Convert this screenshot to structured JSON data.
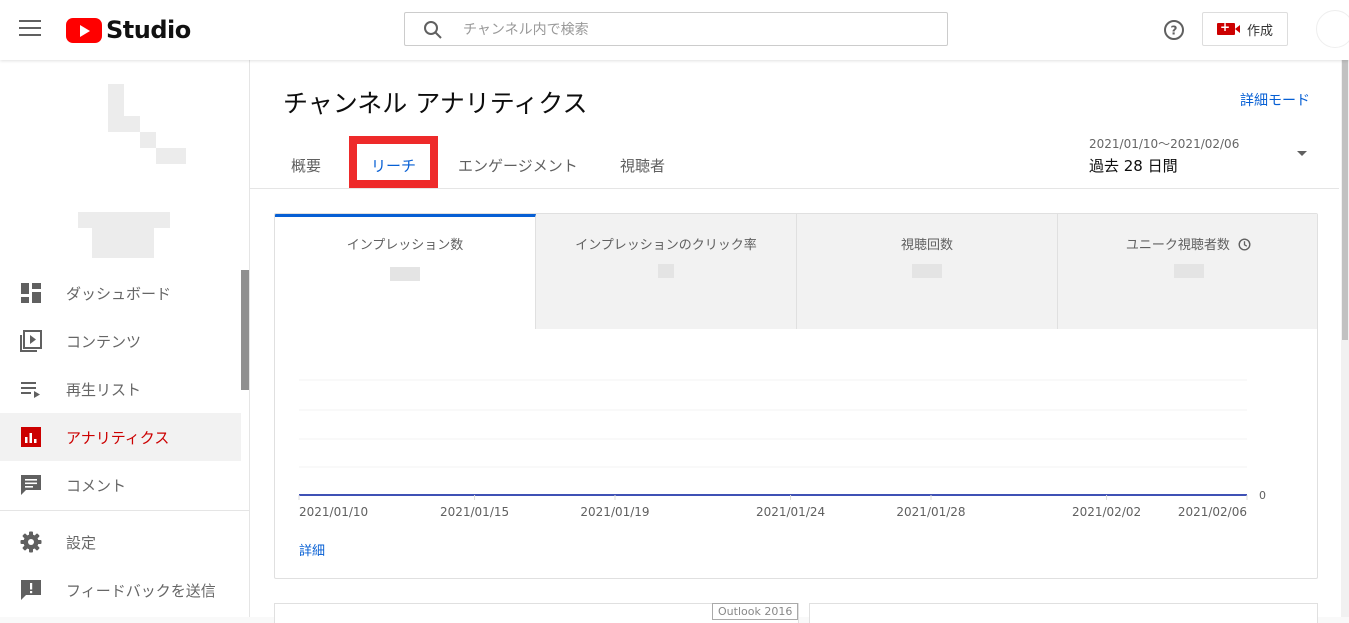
{
  "header": {
    "brand": "Studio",
    "search_placeholder": "チャンネル内で検索",
    "create_label": "作成"
  },
  "sidebar": {
    "items": [
      {
        "label": "ダッシュボード",
        "icon": "dashboard-icon",
        "active": false
      },
      {
        "label": "コンテンツ",
        "icon": "content-icon",
        "active": false
      },
      {
        "label": "再生リスト",
        "icon": "playlist-icon",
        "active": false
      },
      {
        "label": "アナリティクス",
        "icon": "analytics-icon",
        "active": true
      },
      {
        "label": "コメント",
        "icon": "comment-icon",
        "active": false
      }
    ],
    "bottom_items": [
      {
        "label": "設定",
        "icon": "gear-icon"
      },
      {
        "label": "フィードバックを送信",
        "icon": "feedback-icon"
      }
    ]
  },
  "main": {
    "title": "チャンネル アナリティクス",
    "advanced_mode": "詳細モード",
    "tabs": [
      {
        "label": "概要",
        "active": false
      },
      {
        "label": "リーチ",
        "active": true
      },
      {
        "label": "エンゲージメント",
        "active": false
      },
      {
        "label": "視聴者",
        "active": false
      }
    ],
    "date_range": {
      "dates": "2021/01/10～2021/02/06",
      "label": "過去 28 日間"
    },
    "metrics": [
      {
        "label": "インプレッション数",
        "active": true
      },
      {
        "label": "インプレッションのクリック率",
        "active": false
      },
      {
        "label": "視聴回数",
        "active": false
      },
      {
        "label": "ユニーク視聴者数",
        "active": false
      }
    ],
    "more_link": "詳細",
    "overlay_tooltip": "Outlook 2016"
  },
  "colors": {
    "accent": "#065fd4",
    "brand_red": "#ff0000",
    "active_nav": "#cc0000",
    "highlight_box": "#ee2a2a",
    "series_line": "#3f51b5"
  },
  "chart_data": {
    "type": "line",
    "x": [
      "2021/01/10",
      "2021/01/15",
      "2021/01/19",
      "2021/01/24",
      "2021/01/28",
      "2021/02/02",
      "2021/02/06"
    ],
    "y_tick_labels": [
      "0"
    ],
    "series": [
      {
        "values": [
          0,
          0,
          0,
          0,
          0,
          0,
          0
        ]
      }
    ],
    "grid": true
  }
}
